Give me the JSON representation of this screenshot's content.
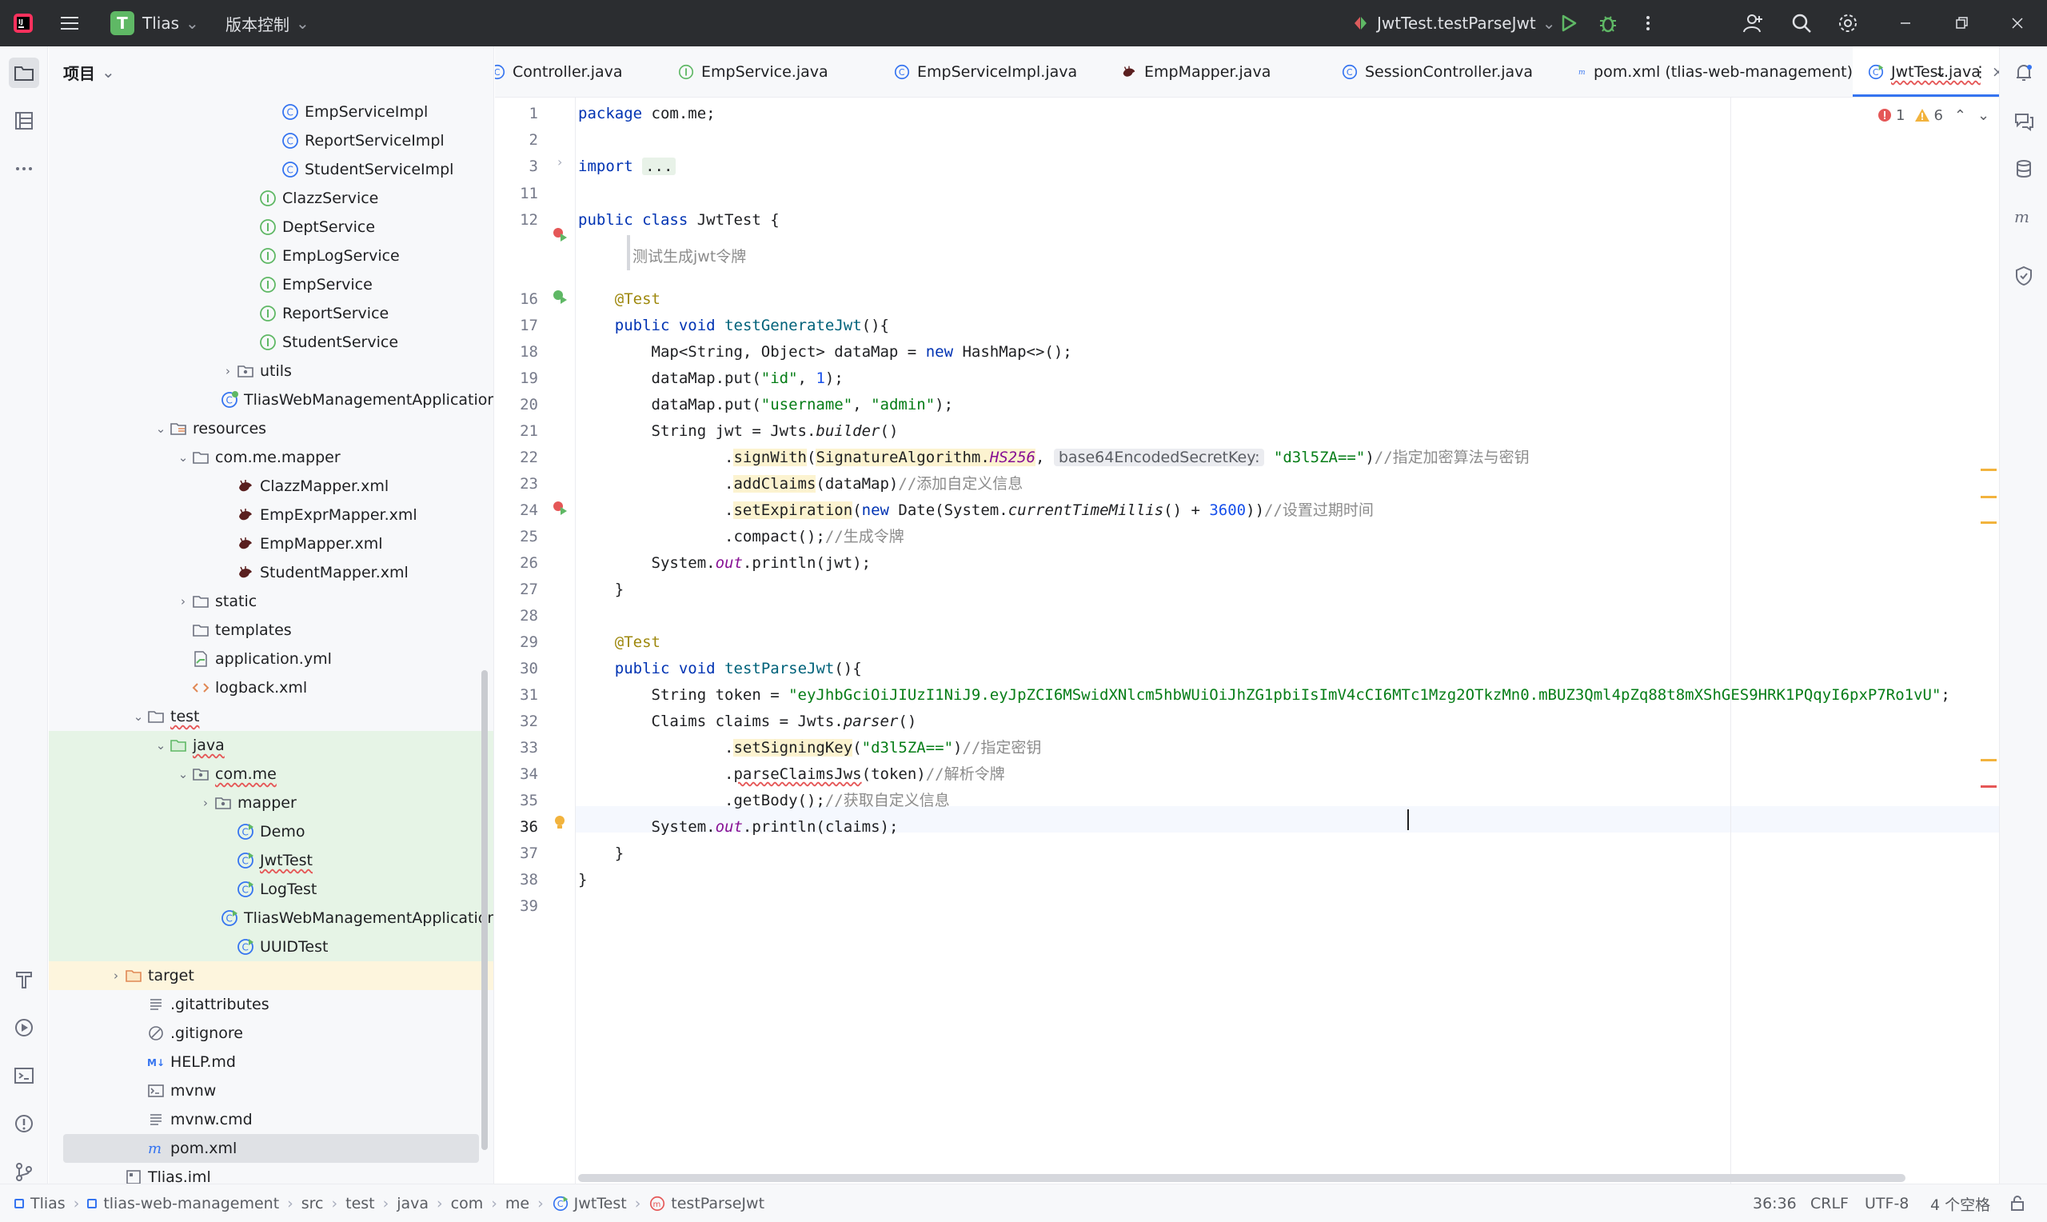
{
  "colors": {
    "titlebar_bg": "#2b2d30",
    "accent": "#3574f0",
    "keyword": "#0033b3",
    "string": "#067d17",
    "annotation": "#9e880d"
  },
  "titlebar": {
    "project_badge": "T",
    "project_name": "Tlias",
    "vcs_label": "版本控制",
    "run_config": "JwtTest.testParseJwt"
  },
  "project_panel": {
    "title": "项目",
    "rows": [
      {
        "label": "EmpServiceImpl",
        "icon": "class-icon",
        "indent": 9,
        "arrow": ""
      },
      {
        "label": "ReportServiceImpl",
        "icon": "class-icon",
        "indent": 9,
        "arrow": ""
      },
      {
        "label": "StudentServiceImpl",
        "icon": "class-icon",
        "indent": 9,
        "arrow": ""
      },
      {
        "label": "ClazzService",
        "icon": "interface-icon",
        "indent": 8,
        "arrow": ""
      },
      {
        "label": "DeptService",
        "icon": "interface-icon",
        "indent": 8,
        "arrow": ""
      },
      {
        "label": "EmpLogService",
        "icon": "interface-icon",
        "indent": 8,
        "arrow": ""
      },
      {
        "label": "EmpService",
        "icon": "interface-icon",
        "indent": 8,
        "arrow": ""
      },
      {
        "label": "ReportService",
        "icon": "interface-icon",
        "indent": 8,
        "arrow": ""
      },
      {
        "label": "StudentService",
        "icon": "interface-icon",
        "indent": 8,
        "arrow": ""
      },
      {
        "label": "utils",
        "icon": "package-icon",
        "indent": 7,
        "arrow": "›"
      },
      {
        "label": "TliasWebManagementApplication",
        "icon": "spring-class-icon",
        "indent": 7,
        "arrow": ""
      },
      {
        "label": "resources",
        "icon": "resources-folder-icon",
        "indent": 4,
        "arrow": "⌄"
      },
      {
        "label": "com.me.mapper",
        "icon": "folder-icon",
        "indent": 5,
        "arrow": "⌄"
      },
      {
        "label": "ClazzMapper.xml",
        "icon": "mybatis-icon",
        "indent": 7,
        "arrow": ""
      },
      {
        "label": "EmpExprMapper.xml",
        "icon": "mybatis-icon",
        "indent": 7,
        "arrow": ""
      },
      {
        "label": "EmpMapper.xml",
        "icon": "mybatis-icon",
        "indent": 7,
        "arrow": ""
      },
      {
        "label": "StudentMapper.xml",
        "icon": "mybatis-icon",
        "indent": 7,
        "arrow": ""
      },
      {
        "label": "static",
        "icon": "folder-icon",
        "indent": 5,
        "arrow": "›"
      },
      {
        "label": "templates",
        "icon": "folder-icon",
        "indent": 5,
        "arrow": ""
      },
      {
        "label": "application.yml",
        "icon": "yaml-icon",
        "indent": 5,
        "arrow": ""
      },
      {
        "label": "logback.xml",
        "icon": "xml-icon",
        "indent": 5,
        "arrow": ""
      },
      {
        "label": "test",
        "icon": "folder-icon",
        "indent": 3,
        "arrow": "⌄",
        "wavy": true
      },
      {
        "label": "java",
        "icon": "test-folder-icon",
        "indent": 4,
        "arrow": "⌄",
        "wavy": true,
        "bg": "green"
      },
      {
        "label": "com.me",
        "icon": "package-icon",
        "indent": 5,
        "arrow": "⌄",
        "wavy": true,
        "bg": "green"
      },
      {
        "label": "mapper",
        "icon": "package-icon",
        "indent": 6,
        "arrow": "›",
        "bg": "green"
      },
      {
        "label": "Demo",
        "icon": "test-class-icon",
        "indent": 7,
        "arrow": "",
        "bg": "green"
      },
      {
        "label": "JwtTest",
        "icon": "test-class-icon",
        "indent": 7,
        "arrow": "",
        "wavy": true,
        "bg": "green"
      },
      {
        "label": "LogTest",
        "icon": "test-class-icon",
        "indent": 7,
        "arrow": "",
        "bg": "green"
      },
      {
        "label": "TliasWebManagementApplicationTe",
        "icon": "test-class-icon",
        "indent": 7,
        "arrow": "",
        "bg": "green"
      },
      {
        "label": "UUIDTest",
        "icon": "test-class-icon",
        "indent": 7,
        "arrow": "",
        "bg": "green"
      },
      {
        "label": "target",
        "icon": "excluded-folder-icon",
        "indent": 2,
        "arrow": "›",
        "bg": "yellow"
      },
      {
        "label": ".gitattributes",
        "icon": "text-file-icon",
        "indent": 3,
        "arrow": ""
      },
      {
        "label": ".gitignore",
        "icon": "ignore-file-icon",
        "indent": 3,
        "arrow": ""
      },
      {
        "label": "HELP.md",
        "icon": "markdown-icon",
        "indent": 3,
        "arrow": ""
      },
      {
        "label": "mvnw",
        "icon": "shell-icon",
        "indent": 3,
        "arrow": ""
      },
      {
        "label": "mvnw.cmd",
        "icon": "text-file-icon",
        "indent": 3,
        "arrow": ""
      },
      {
        "label": "pom.xml",
        "icon": "maven-icon",
        "indent": 3,
        "arrow": "",
        "bg": "sel"
      },
      {
        "label": "Tlias.iml",
        "icon": "iml-icon",
        "indent": 2,
        "arrow": ""
      }
    ]
  },
  "tabs": [
    {
      "label": "Controller.java",
      "icon": "class-icon"
    },
    {
      "label": "EmpService.java",
      "icon": "interface-icon"
    },
    {
      "label": "EmpServiceImpl.java",
      "icon": "class-icon"
    },
    {
      "label": "EmpMapper.java",
      "icon": "mybatis-icon"
    },
    {
      "label": "SessionController.java",
      "icon": "class-icon"
    },
    {
      "label": "pom.xml (tlias-web-management)",
      "icon": "maven-icon"
    },
    {
      "label": "JwtTest.java",
      "icon": "test-class-icon",
      "active": true
    }
  ],
  "inspections": {
    "errors": "1",
    "warnings": "6"
  },
  "editor": {
    "doc_comment": "测试生成jwt令牌",
    "lines": [
      {
        "n": "1",
        "html": "<span class='kw'>package</span> com.me;"
      },
      {
        "n": "2",
        "html": ""
      },
      {
        "n": "3",
        "html": "<span class='kw'>import</span> <span class='fold'>...</span>"
      },
      {
        "n": "11",
        "html": ""
      },
      {
        "n": "12",
        "html": "<span class='kw'>public class</span> JwtTest {"
      },
      {
        "n": "",
        "html": ""
      },
      {
        "n": "16",
        "html": "    <span class='ann'>@Test</span>"
      },
      {
        "n": "17",
        "html": "    <span class='kw'>public void</span> <span class='fn'>testGenerateJwt</span>(){"
      },
      {
        "n": "18",
        "html": "        Map&lt;String, Object&gt; dataMap = <span class='kw'>new</span> HashMap&lt;&gt;();"
      },
      {
        "n": "19",
        "html": "        dataMap.put(<span class='str'>\"id\"</span>, <span class='num'>1</span>);"
      },
      {
        "n": "20",
        "html": "        dataMap.put(<span class='str'>\"username\"</span>, <span class='str'>\"admin\"</span>);"
      },
      {
        "n": "21",
        "html": "        String jwt = Jwts.<span class='ital'>builder</span>()"
      },
      {
        "n": "22",
        "html": "                .<span class='hl-y'>signWith</span>(<span class='hl-y'>SignatureAlgorithm.<span class='stat'>HS256</span></span>, <span class='hint'>base64EncodedSecretKey:</span> <span class='str'>\"d3l5ZA==\"</span>)<span class='cmt'>//指定加密算法与密钥</span>"
      },
      {
        "n": "23",
        "html": "                .<span class='hl-y'>addClaims</span>(dataMap)<span class='cmt'>//添加自定义信息</span>"
      },
      {
        "n": "24",
        "html": "                .<span class='hl-y'>setExpiration</span>(<span class='kw'>new</span> Date(System.<span class='ital'>currentTimeMillis</span>() + <span class='num'>3600</span>))<span class='cmt'>//设置过期时间</span>"
      },
      {
        "n": "25",
        "html": "                .compact();<span class='cmt'>//生成令牌</span>"
      },
      {
        "n": "26",
        "html": "        System.<span class='stat'>out</span>.println(jwt);"
      },
      {
        "n": "27",
        "html": "    }"
      },
      {
        "n": "28",
        "html": ""
      },
      {
        "n": "29",
        "html": "    <span class='ann'>@Test</span>"
      },
      {
        "n": "30",
        "html": "    <span class='kw'>public void</span> <span class='fn'>testParseJwt</span>(){"
      },
      {
        "n": "31",
        "html": "        String token = <span class='str'>\"eyJhbGciOiJIUzI1NiJ9.eyJpZCI6MSwidXNlcm5hbWUiOiJhZG1pbiIsImV4cCI6MTc1Mzg2OTkzMn0.mBUZ3Qml4pZq88t8mXShGES9HRK1PQqyI6pxP7Ro1vU\"</span>;"
      },
      {
        "n": "32",
        "html": "        Claims claims = Jwts.<span class='ital'>parser</span>()"
      },
      {
        "n": "33",
        "html": "                .<span class='hl-y'>setSigningKey</span>(<span class='str'>\"d3l5ZA==\"</span>)<span class='cmt'>//指定密钥</span>"
      },
      {
        "n": "34",
        "html": "                .<span class='redu'>parseClaimsJws</span>(token)<span class='cmt'>//解析令牌</span>"
      },
      {
        "n": "35",
        "html": "                .getBody();<span class='cmt'>//获取自定义信息</span>"
      },
      {
        "n": "36",
        "html": "        System.<span class='stat'>out</span>.println(claims);"
      },
      {
        "n": "37",
        "html": "    }"
      },
      {
        "n": "38",
        "html": "}"
      },
      {
        "n": "39",
        "html": ""
      }
    ]
  },
  "statusbar": {
    "breadcrumbs": [
      "Tlias",
      "tlias-web-management",
      "src",
      "test",
      "java",
      "com",
      "me",
      "JwtTest",
      "testParseJwt"
    ],
    "position": "36:36",
    "line_sep": "CRLF",
    "encoding": "UTF-8",
    "indent": "4 个空格"
  }
}
